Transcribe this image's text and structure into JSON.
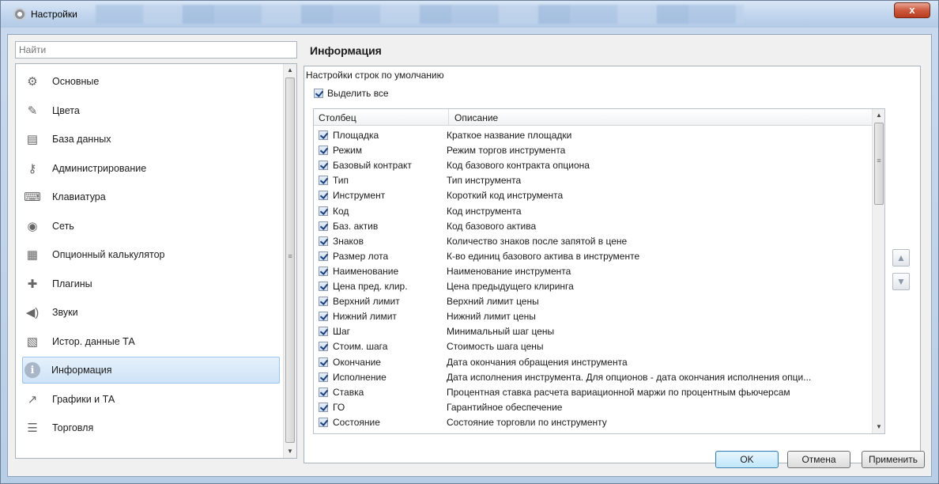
{
  "window": {
    "title": "Настройки",
    "close_label": "x"
  },
  "search": {
    "placeholder": "Найти"
  },
  "sidebar": {
    "items": [
      {
        "label": "Основные",
        "icon": "gear-icon"
      },
      {
        "label": "Цвета",
        "icon": "brush-icon"
      },
      {
        "label": "База данных",
        "icon": "database-icon"
      },
      {
        "label": "Администрирование",
        "icon": "key-icon"
      },
      {
        "label": "Клавиатура",
        "icon": "keyboard-icon"
      },
      {
        "label": "Сеть",
        "icon": "network-icon"
      },
      {
        "label": "Опционный калькулятор",
        "icon": "calculator-icon"
      },
      {
        "label": "Плагины",
        "icon": "puzzle-icon"
      },
      {
        "label": "Звуки",
        "icon": "speaker-icon"
      },
      {
        "label": "Истор. данные ТА",
        "icon": "history-chart-icon"
      },
      {
        "label": "Информация",
        "icon": "info-icon",
        "active": true
      },
      {
        "label": "Графики и ТА",
        "icon": "line-chart-icon"
      },
      {
        "label": "Торговля",
        "icon": "coins-icon"
      }
    ]
  },
  "main": {
    "title": "Информация",
    "defaults_label": "Настройки строк по умолчанию",
    "select_all_label": "Выделить все",
    "columns": [
      "Столбец",
      "Описание"
    ],
    "rows": [
      {
        "name": "Площадка",
        "desc": "Краткое название площадки",
        "checked": true
      },
      {
        "name": "Режим",
        "desc": "Режим торгов инструмента",
        "checked": true
      },
      {
        "name": "Базовый контракт",
        "desc": "Код базового контракта опциона",
        "checked": true
      },
      {
        "name": "Тип",
        "desc": "Тип инструмента",
        "checked": true
      },
      {
        "name": "Инструмент",
        "desc": "Короткий код инструмента",
        "checked": true
      },
      {
        "name": "Код",
        "desc": "Код инструмента",
        "checked": true
      },
      {
        "name": "Баз. актив",
        "desc": "Код базового актива",
        "checked": true
      },
      {
        "name": "Знаков",
        "desc": "Количество знаков после запятой в цене",
        "checked": true
      },
      {
        "name": "Размер лота",
        "desc": "К-во единиц базового актива в инструменте",
        "checked": true
      },
      {
        "name": "Наименование",
        "desc": "Наименование инструмента",
        "checked": true
      },
      {
        "name": "Цена пред. клир.",
        "desc": "Цена предыдущего клиринга",
        "checked": true
      },
      {
        "name": "Верхний лимит",
        "desc": "Верхний лимит цены",
        "checked": true
      },
      {
        "name": "Нижний лимит",
        "desc": "Нижний лимит цены",
        "checked": true
      },
      {
        "name": "Шаг",
        "desc": "Минимальный шаг цены",
        "checked": true
      },
      {
        "name": "Стоим. шага",
        "desc": "Стоимость шага цены",
        "checked": true
      },
      {
        "name": "Окончание",
        "desc": "Дата окончания обращения инструмента",
        "checked": true
      },
      {
        "name": "Исполнение",
        "desc": "Дата исполнения инструмента. Для опционов - дата окончания исполнения опци...",
        "checked": true
      },
      {
        "name": "Ставка",
        "desc": "Процентная ставка расчета вариационной маржи по процентным фьючерсам",
        "checked": true
      },
      {
        "name": "ГО",
        "desc": "Гарантийное обеспечение",
        "checked": true
      },
      {
        "name": "Состояние",
        "desc": "Состояние торговли по инструменту",
        "checked": true
      }
    ]
  },
  "buttons": {
    "ok": "OK",
    "cancel": "Отмена",
    "apply": "Применить"
  }
}
